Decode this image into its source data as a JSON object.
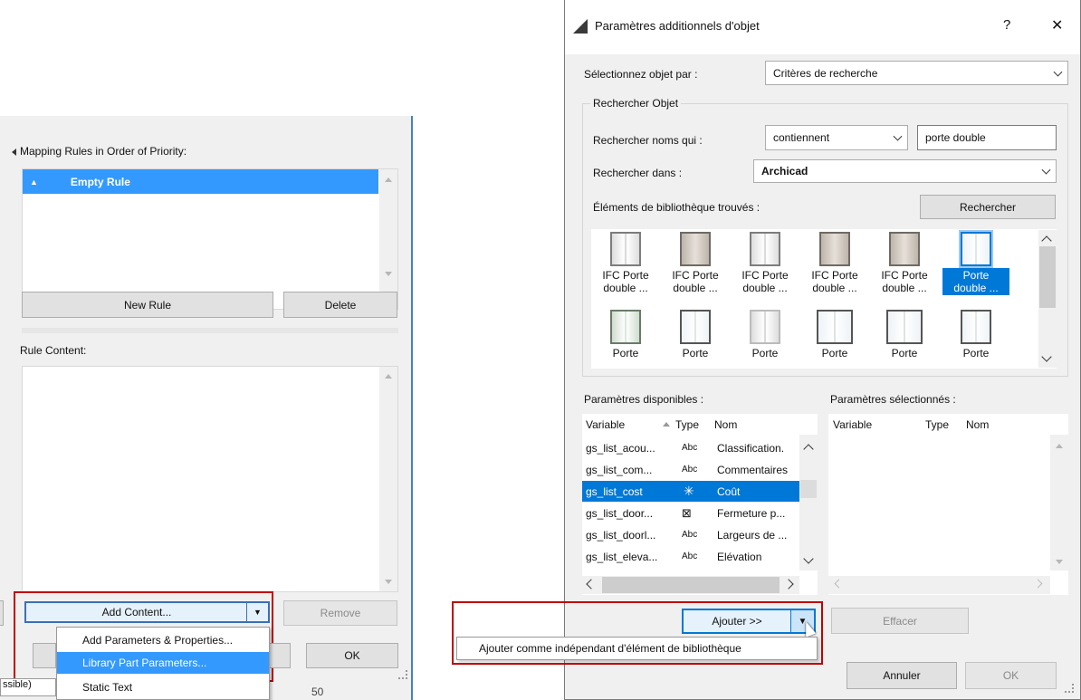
{
  "left_panel": {
    "mapping_title": "Mapping Rules in Order of Priority:",
    "rule_item": "Empty Rule",
    "new_rule_label": "New Rule",
    "delete_label": "Delete",
    "rule_content_title": "Rule Content:",
    "add_content_label": "Add Content...",
    "remove_label": "Remove",
    "ok_label": "OK",
    "menu_items": [
      "Add Parameters & Properties...",
      "Library Part Parameters...",
      "Static Text"
    ],
    "status_left": "ssible)",
    "status_num": "50"
  },
  "dialog": {
    "title": "Paramètres additionnels d'objet",
    "help": "?",
    "close": "✕",
    "select_by_label": "Sélectionnez objet par :",
    "select_by_value": "Critères de recherche",
    "search_group_title": "Rechercher Objet",
    "search_names_label": "Rechercher noms qui :",
    "search_mode_value": "contiennent",
    "search_text_value": "porte double",
    "search_in_label": "Rechercher dans :",
    "search_in_value": "Archicad",
    "found_label": "Éléments de bibliothèque trouvés :",
    "search_button": "Rechercher",
    "thumbs_row1": [
      {
        "l1": "IFC Porte",
        "l2": "double ..."
      },
      {
        "l1": "IFC Porte",
        "l2": "double ..."
      },
      {
        "l1": "IFC Porte",
        "l2": "double ..."
      },
      {
        "l1": "IFC Porte",
        "l2": "double ..."
      },
      {
        "l1": "IFC Porte",
        "l2": "double ..."
      },
      {
        "l1": "Porte",
        "l2": "double ..."
      }
    ],
    "thumbs_row2": [
      "Porte",
      "Porte",
      "Porte",
      "Porte",
      "Porte",
      "Porte"
    ],
    "available_title": "Paramètres disponibles :",
    "selected_title": "Paramètres sélectionnés :",
    "col_variable": "Variable",
    "col_type": "Type",
    "col_name": "Nom",
    "params": [
      {
        "var": "gs_list_acou...",
        "type": "Abc",
        "name": "Classification."
      },
      {
        "var": "gs_list_com...",
        "type": "Abc",
        "name": "Commentaires"
      },
      {
        "var": "gs_list_cost",
        "type": "✳",
        "name": "Coût"
      },
      {
        "var": "gs_list_door...",
        "type": "⊠",
        "name": "Fermeture p..."
      },
      {
        "var": "gs_list_doorl...",
        "type": "Abc",
        "name": "Largeurs de ..."
      },
      {
        "var": "gs_list_eleva...",
        "type": "Abc",
        "name": "Elévation"
      }
    ],
    "add_button": "Ajouter >>",
    "add_menu_item": "Ajouter comme indépendant d'élément de bibliothèque",
    "clear_button": "Effacer",
    "cancel_button": "Annuler",
    "ok_button": "OK"
  },
  "colors": {
    "selection": "#0078d7",
    "highlight_red": "#c00000",
    "selected_blue": "#3399ff"
  }
}
